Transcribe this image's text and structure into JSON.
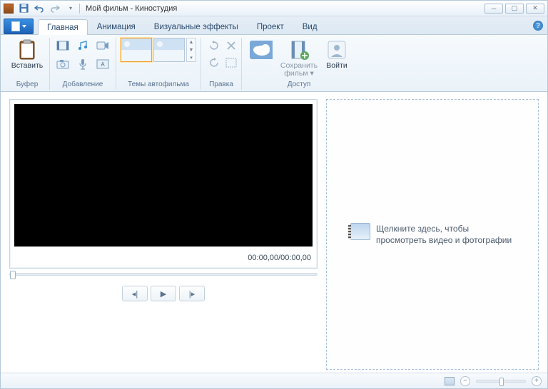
{
  "title": "Мой фильм - Киностудия",
  "tabs": {
    "home": "Главная",
    "animation": "Анимация",
    "effects": "Визуальные эффекты",
    "project": "Проект",
    "view": "Вид"
  },
  "ribbon": {
    "paste": {
      "label": "Вставить"
    },
    "buffer_group": "Буфер",
    "add_group": "Добавление",
    "autothemes_group": "Темы автофильма",
    "edit_group": "Правка",
    "access_group": "Доступ",
    "save_movie": {
      "line1": "Сохранить",
      "line2": "фильм ▾"
    },
    "login": {
      "label": "Войти"
    }
  },
  "preview": {
    "timecode": "00:00,00/00:00,00"
  },
  "drop": {
    "text": "Щелкните здесь, чтобы просмотреть видео и фотографии"
  }
}
